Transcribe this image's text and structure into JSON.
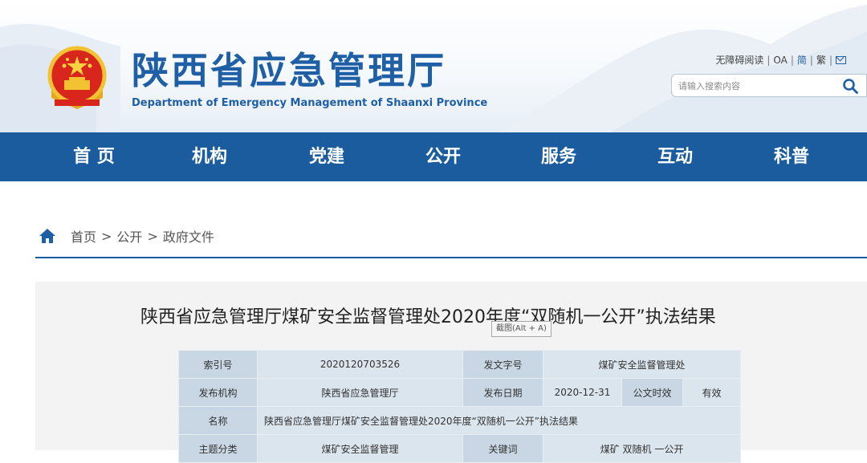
{
  "site": {
    "title": "陕西省应急管理厅",
    "subtitle": "Department of Emergency Management of Shaanxi Province"
  },
  "toplinks": {
    "accessible": "无障碍阅读",
    "oa": "OA",
    "simplified": "简",
    "traditional": "繁",
    "mail_icon": "mail-icon"
  },
  "search": {
    "placeholder": "请输入搜索内容",
    "icon": "search-icon"
  },
  "nav": {
    "items": [
      {
        "label": "首 页"
      },
      {
        "label": "机构"
      },
      {
        "label": "党建"
      },
      {
        "label": "公开"
      },
      {
        "label": "服务"
      },
      {
        "label": "互动"
      },
      {
        "label": "科普"
      }
    ]
  },
  "breadcrumb": {
    "icon": "home-icon",
    "items": [
      "首页",
      "公开",
      "政府文件"
    ],
    "separator": ">"
  },
  "article": {
    "title": "陕西省应急管理厅煤矿安全监督管理处2020年度“双随机一公开”执法结果",
    "tooltip": "截图(Alt + A)"
  },
  "info_table": {
    "index_label": "索引号",
    "index_value": "2020120703526",
    "doc_no_label": "发文字号",
    "doc_no_value": "煤矿安全监督管理处",
    "publisher_label": "发布机构",
    "publisher_value": "陕西省应急管理厅",
    "date_label": "发布日期",
    "date_value": "2020-12-31",
    "validity_label": "公文时效",
    "validity_value": "有效",
    "name_label": "名称",
    "name_value": "陕西省应急管理厅煤矿安全监督管理处2020年度“双随机一公开”执法结果",
    "topic_label": "主题分类",
    "topic_value": "煤矿安全监督管理",
    "keywords_label": "关键词",
    "keywords_value": "煤矿 双随机 一公开"
  },
  "colors": {
    "brand_blue": "#1f5fa6",
    "nav_blue": "#1a5c9e",
    "table_label": "#c9d7e4",
    "table_value": "#dbe5ee"
  }
}
